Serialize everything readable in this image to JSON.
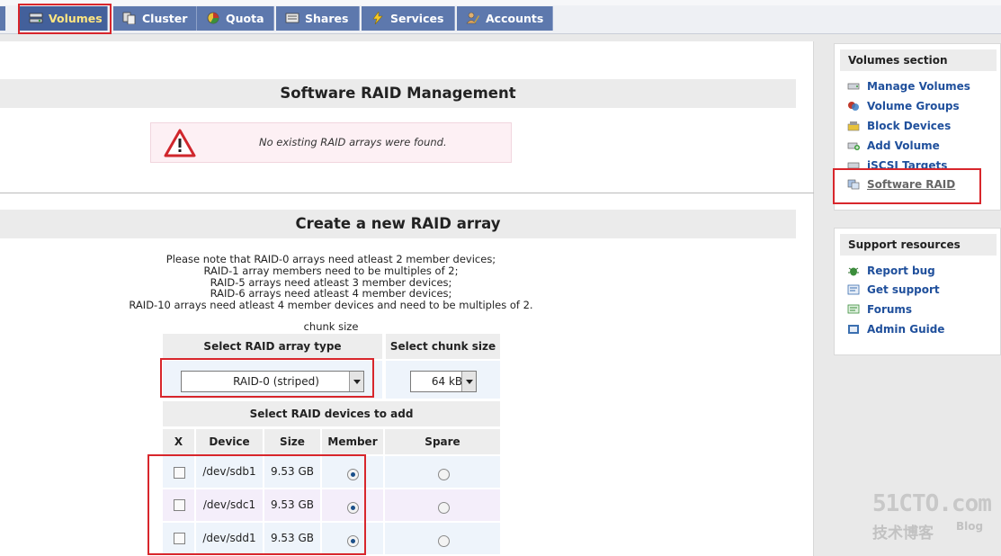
{
  "nav": {
    "tabs": [
      {
        "label": "Volumes",
        "icon": "volumes-icon",
        "active": true
      },
      {
        "label": "Cluster",
        "icon": "cluster-icon"
      },
      {
        "label": "Quota",
        "icon": "quota-icon"
      },
      {
        "label": "Shares",
        "icon": "shares-icon"
      },
      {
        "label": "Services",
        "icon": "services-icon"
      },
      {
        "label": "Accounts",
        "icon": "accounts-icon"
      }
    ]
  },
  "raid_mgmt": {
    "title": "Software RAID Management",
    "alert_text": "No existing RAID arrays were found.",
    "alert_icon": "warning-icon"
  },
  "create": {
    "title": "Create a new RAID array",
    "notes": [
      "Please note that RAID-0 arrays need atleast 2 member devices;",
      "RAID-1 array members need to be multiples of 2;",
      "RAID-5 arrays need atleast 3 member devices;",
      "RAID-6 arrays need atleast 4 member devices;",
      "RAID-10 arrays need atleast 4 member devices and need to be multiples of 2."
    ],
    "chunk_caption": "chunk size",
    "type_header": "Select RAID array type",
    "chunk_header": "Select chunk size",
    "type_value": "RAID-0 (striped)",
    "chunk_value": "64 kB",
    "devices_header": "Select RAID devices to add",
    "columns": [
      "X",
      "Device",
      "Size",
      "Member",
      "Spare"
    ],
    "devices": [
      {
        "device": "/dev/sdb1",
        "size": "9.53 GB",
        "checked": false,
        "role": "member"
      },
      {
        "device": "/dev/sdc1",
        "size": "9.53 GB",
        "checked": false,
        "role": "member"
      },
      {
        "device": "/dev/sdd1",
        "size": "9.53 GB",
        "checked": false,
        "role": "member"
      }
    ]
  },
  "sidebar": {
    "volumes_title": "Volumes section",
    "volumes_items": [
      {
        "label": "Manage Volumes",
        "icon": "drive-icon"
      },
      {
        "label": "Volume Groups",
        "icon": "volume-groups-icon"
      },
      {
        "label": "Block Devices",
        "icon": "block-devices-icon"
      },
      {
        "label": "Add Volume",
        "icon": "add-volume-icon"
      },
      {
        "label": "iSCSI Targets",
        "icon": "iscsi-icon"
      },
      {
        "label": "Software RAID",
        "icon": "software-raid-icon",
        "current": true
      }
    ],
    "support_title": "Support resources",
    "support_items": [
      {
        "label": "Report bug",
        "icon": "bug-icon"
      },
      {
        "label": "Get support",
        "icon": "support-icon"
      },
      {
        "label": "Forums",
        "icon": "forums-icon"
      },
      {
        "label": "Admin Guide",
        "icon": "book-icon"
      }
    ]
  },
  "watermark": {
    "main": "51CTO.com",
    "sub": "技术博客",
    "blog": "Blog"
  },
  "colors": {
    "tab_bg": "#5d78ad",
    "link": "#20509c",
    "highlight": "#d8262c"
  }
}
